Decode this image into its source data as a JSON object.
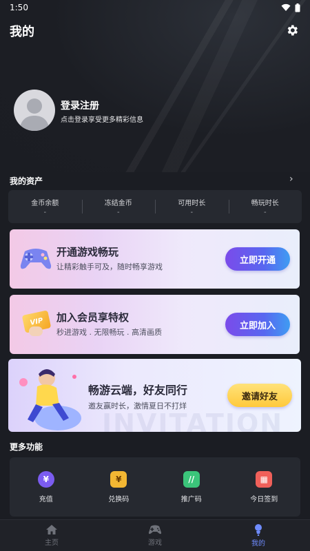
{
  "status": {
    "time": "1:50"
  },
  "header": {
    "title": "我的"
  },
  "profile": {
    "login_title": "登录注册",
    "login_subtitle": "点击登录享受更多精彩信息"
  },
  "assets": {
    "title": "我的资产",
    "items": [
      {
        "label": "金币余额",
        "value": "-"
      },
      {
        "label": "冻结金币",
        "value": "-"
      },
      {
        "label": "可用时长",
        "value": "-"
      },
      {
        "label": "畅玩时长",
        "value": "-"
      }
    ]
  },
  "banners": {
    "game": {
      "title": "开通游戏畅玩",
      "subtitle": "让精彩触手可及，随时畅享游戏",
      "button": "立即开通"
    },
    "vip": {
      "title": "加入会员享特权",
      "subtitle": "秒进游戏 . 无限畅玩 . 高清画质",
      "button": "立即加入",
      "badge": "VIP"
    },
    "invite": {
      "title": "畅游云端，好友同行",
      "subtitle": "邀友赢时长，激情夏日不打烊",
      "button": "邀请好友",
      "watermark": "INVITATION"
    }
  },
  "more": {
    "title": "更多功能",
    "items": [
      {
        "label": "充值",
        "icon": "recharge-icon",
        "color": "#7b5cf0"
      },
      {
        "label": "兑换码",
        "icon": "redeem-icon",
        "color": "#f3b733"
      },
      {
        "label": "推广码",
        "icon": "promo-code-icon",
        "color": "#3bc47a"
      },
      {
        "label": "今日签到",
        "icon": "checkin-icon",
        "color": "#f0605a"
      }
    ]
  },
  "tabbar": {
    "items": [
      {
        "label": "主页",
        "icon": "home-icon"
      },
      {
        "label": "游戏",
        "icon": "gamepad-icon"
      },
      {
        "label": "我的",
        "icon": "profile-icon",
        "active": true
      }
    ]
  },
  "colors": {
    "accent": "#6f8cff",
    "background": "#1b1d23",
    "card": "#262930"
  }
}
